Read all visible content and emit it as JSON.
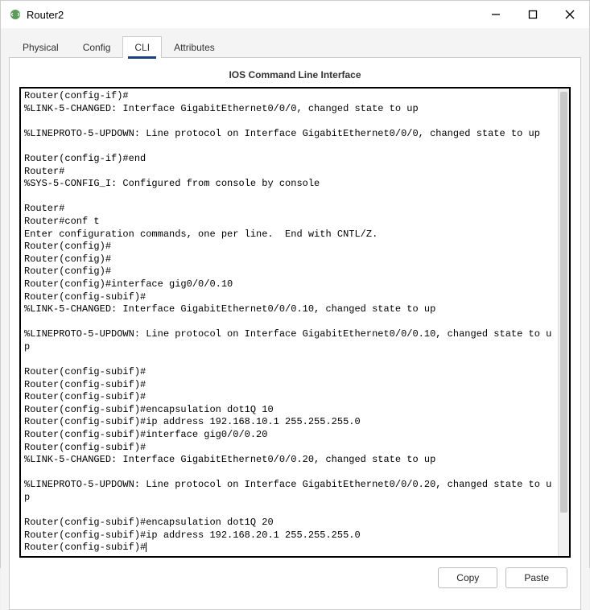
{
  "window": {
    "title": "Router2"
  },
  "tabs": {
    "physical": "Physical",
    "config": "Config",
    "cli": "CLI",
    "attributes": "Attributes"
  },
  "cli": {
    "header": "IOS Command Line Interface",
    "terminal": "Router(config-if)#\n%LINK-5-CHANGED: Interface GigabitEthernet0/0/0, changed state to up\n\n%LINEPROTO-5-UPDOWN: Line protocol on Interface GigabitEthernet0/0/0, changed state to up\n\nRouter(config-if)#end\nRouter#\n%SYS-5-CONFIG_I: Configured from console by console\n\nRouter#\nRouter#conf t\nEnter configuration commands, one per line.  End with CNTL/Z.\nRouter(config)#\nRouter(config)#\nRouter(config)#\nRouter(config)#interface gig0/0/0.10\nRouter(config-subif)#\n%LINK-5-CHANGED: Interface GigabitEthernet0/0/0.10, changed state to up\n\n%LINEPROTO-5-UPDOWN: Line protocol on Interface GigabitEthernet0/0/0.10, changed state to up\n\nRouter(config-subif)#\nRouter(config-subif)#\nRouter(config-subif)#\nRouter(config-subif)#encapsulation dot1Q 10\nRouter(config-subif)#ip address 192.168.10.1 255.255.255.0\nRouter(config-subif)#interface gig0/0/0.20\nRouter(config-subif)#\n%LINK-5-CHANGED: Interface GigabitEthernet0/0/0.20, changed state to up\n\n%LINEPROTO-5-UPDOWN: Line protocol on Interface GigabitEthernet0/0/0.20, changed state to up\n\nRouter(config-subif)#encapsulation dot1Q 20\nRouter(config-subif)#ip address 192.168.20.1 255.255.255.0\nRouter(config-subif)#"
  },
  "buttons": {
    "copy": "Copy",
    "paste": "Paste"
  }
}
